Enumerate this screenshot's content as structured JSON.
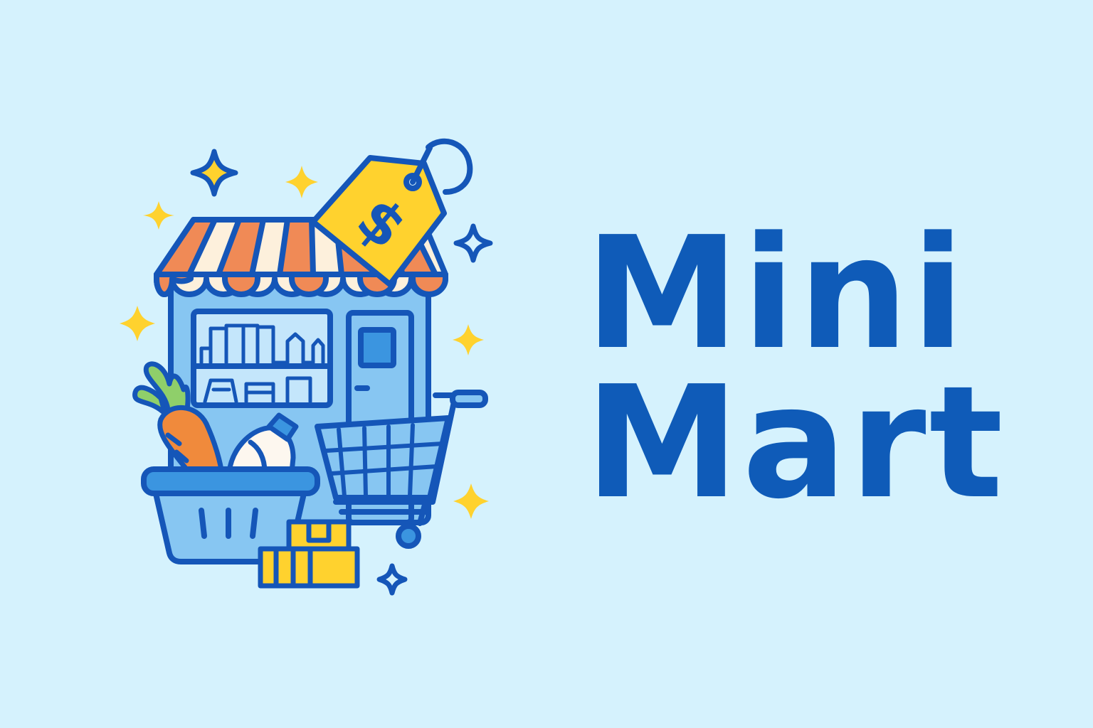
{
  "logo": {
    "name_line_1": "Mini",
    "name_line_2": "Mart",
    "price_symbol": "$",
    "icon": "storefront-logo-icon"
  },
  "colors": {
    "background": "#d5f2fd",
    "brand_text": "#0f5bb8",
    "outline": "#1556b8",
    "store_fill": "#87c6f2",
    "awning_orange": "#f08a56",
    "awning_cream": "#fdf0dc",
    "tag_yellow": "#ffd22e",
    "sparkle_yellow": "#ffd22e",
    "carrot_orange": "#f08a3c",
    "leaf_green": "#8fcf6a"
  }
}
